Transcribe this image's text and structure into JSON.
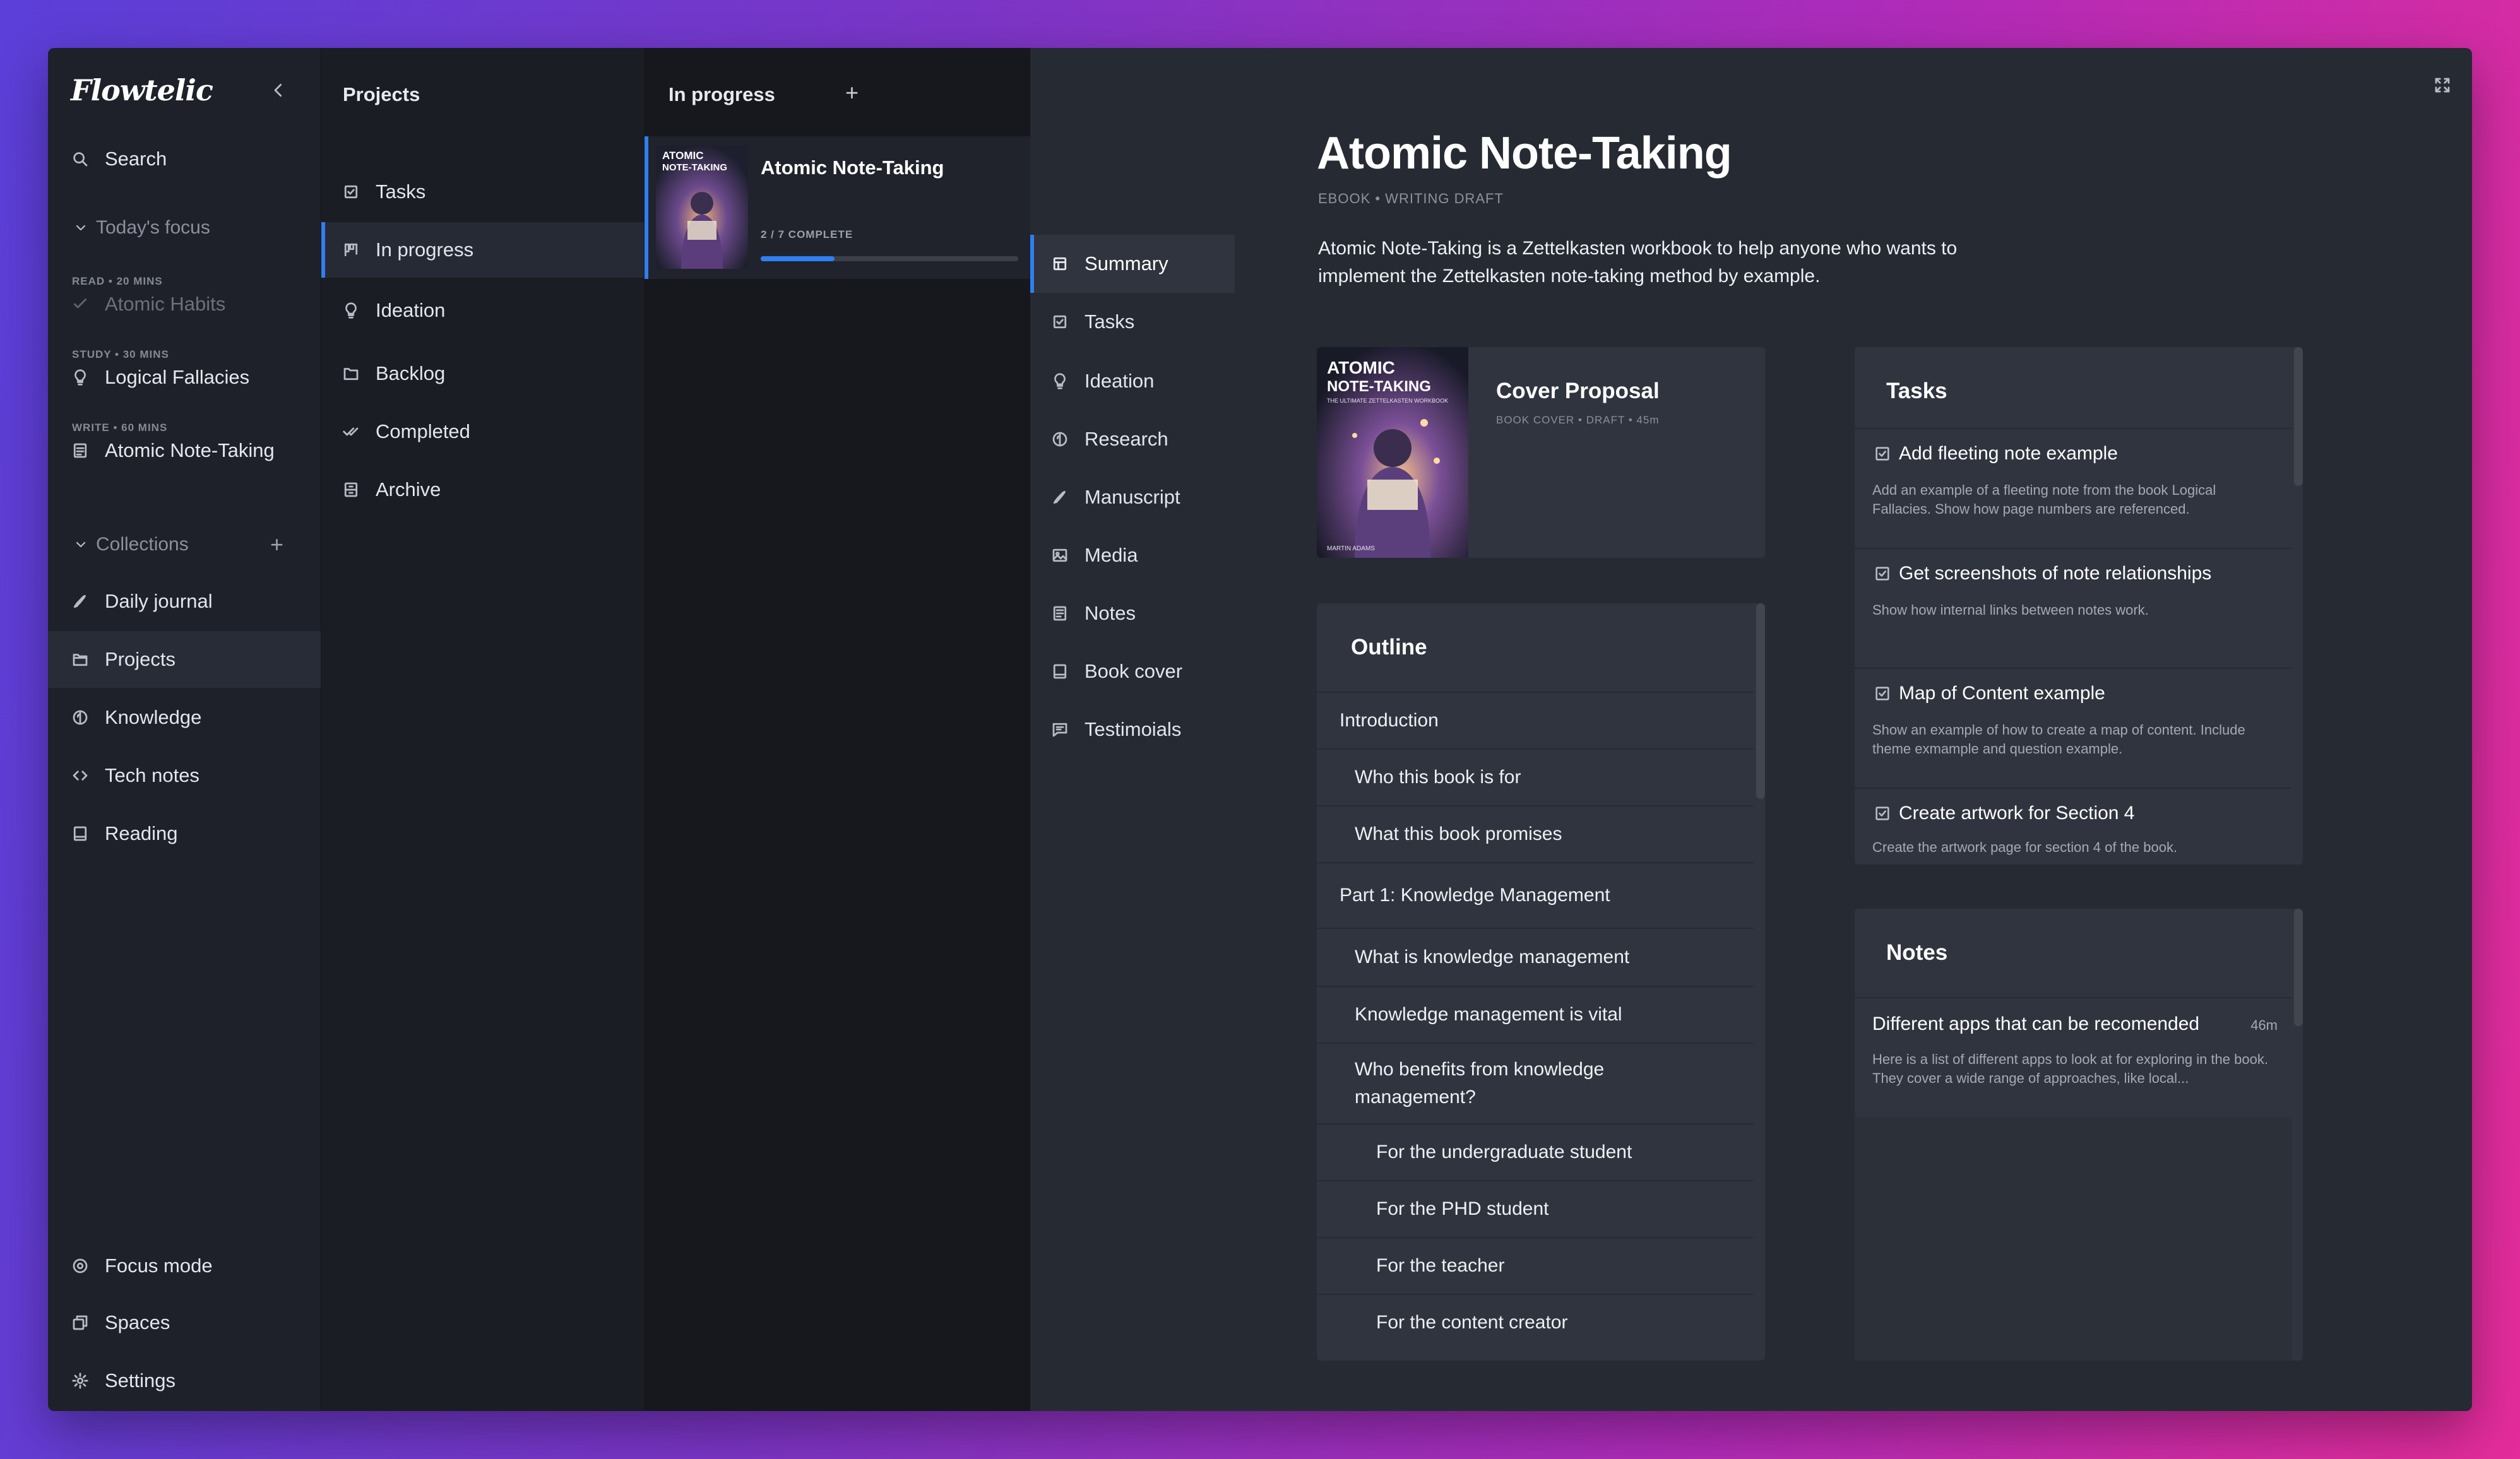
{
  "app": {
    "logo": "Flowtelic"
  },
  "sidebar": {
    "search_label": "Search",
    "todays_focus": {
      "label": "Today's focus",
      "items": [
        {
          "meta": "READ • 20 MINS",
          "label": "Atomic Habits",
          "done": true,
          "icon": "check-icon"
        },
        {
          "meta": "STUDY • 30 MINS",
          "label": "Logical Fallacies",
          "done": false,
          "icon": "bulb-icon"
        },
        {
          "meta": "WRITE • 60 MINS",
          "label": "Atomic Note-Taking",
          "done": false,
          "icon": "document-icon"
        }
      ]
    },
    "collections": {
      "label": "Collections",
      "add_label": "+",
      "items": [
        {
          "label": "Daily journal",
          "icon": "pen-icon"
        },
        {
          "label": "Projects",
          "icon": "folder-icon",
          "active": true
        },
        {
          "label": "Knowledge",
          "icon": "knowledge-icon"
        },
        {
          "label": "Tech notes",
          "icon": "code-icon"
        },
        {
          "label": "Reading",
          "icon": "book-icon"
        }
      ]
    },
    "footer": [
      {
        "label": "Focus mode",
        "icon": "target-icon"
      },
      {
        "label": "Spaces",
        "icon": "spaces-icon"
      },
      {
        "label": "Settings",
        "icon": "gear-icon"
      }
    ]
  },
  "projects": {
    "title": "Projects",
    "items": [
      {
        "label": "Tasks",
        "icon": "checkbox-icon"
      },
      {
        "label": "In progress",
        "icon": "kanban-icon",
        "active": true
      },
      {
        "label": "Ideation",
        "icon": "bulb-icon"
      },
      {
        "label": "Backlog",
        "icon": "folder-icon"
      },
      {
        "label": "Completed",
        "icon": "double-check-icon"
      },
      {
        "label": "Archive",
        "icon": "archive-icon"
      }
    ]
  },
  "in_progress": {
    "title": "In progress",
    "add_label": "+",
    "card": {
      "title": "Atomic Note-Taking",
      "progress_label": "2 / 7 COMPLETE",
      "progress_fraction": 0.2857,
      "cover_title_line1": "ATOMIC",
      "cover_title_line2": "NOTE-TAKING"
    }
  },
  "detail_tabs": [
    {
      "label": "Summary",
      "icon": "summary-icon",
      "active": true
    },
    {
      "label": "Tasks",
      "icon": "checkbox-icon"
    },
    {
      "label": "Ideation",
      "icon": "bulb-icon"
    },
    {
      "label": "Research",
      "icon": "knowledge-icon"
    },
    {
      "label": "Manuscript",
      "icon": "pen-icon"
    },
    {
      "label": "Media",
      "icon": "image-icon"
    },
    {
      "label": "Notes",
      "icon": "notes-icon"
    },
    {
      "label": "Book cover",
      "icon": "book-icon"
    },
    {
      "label": "Testimoials",
      "icon": "quote-icon"
    }
  ],
  "main": {
    "title": "Atomic Note-Taking",
    "subtitle": "EBOOK • WRITING DRAFT",
    "description": "Atomic Note-Taking is a Zettelkasten workbook to help anyone who wants to implement the Zettelkasten note-taking method by example.",
    "cover_card": {
      "title": "Cover Proposal",
      "meta": "BOOK COVER • DRAFT • 45m",
      "cover_line1": "ATOMIC",
      "cover_line2": "NOTE-TAKING",
      "cover_tagline": "THE ULTIMATE ZETTELKASTEN WORKBOOK",
      "cover_author": "MARTIN ADAMS"
    },
    "outline": {
      "title": "Outline",
      "rows": [
        {
          "label": "Introduction",
          "level": 0
        },
        {
          "label": "Who this book is for",
          "level": 1
        },
        {
          "label": "What this book promises",
          "level": 1
        },
        {
          "label": "Part 1: Knowledge Management",
          "level": 0
        },
        {
          "label": "What is knowledge management",
          "level": 1
        },
        {
          "label": "Knowledge management is vital",
          "level": 1
        },
        {
          "label": "Who benefits from knowledge management?",
          "level": 1
        },
        {
          "label": "For the undergraduate student",
          "level": 2
        },
        {
          "label": "For the PHD student",
          "level": 2
        },
        {
          "label": "For the teacher",
          "level": 2
        },
        {
          "label": "For the content creator",
          "level": 2
        }
      ]
    },
    "tasks": {
      "title": "Tasks",
      "items": [
        {
          "title": "Add fleeting note example",
          "desc": "Add an example of a fleeting note from the book Logical Fallacies. Show how page numbers are referenced."
        },
        {
          "title": "Get screenshots of note relationships",
          "desc": "Show how internal links between notes work."
        },
        {
          "title": "Map of Content example",
          "desc": "Show an example of how to create a map of content. Include theme exmample and question example."
        },
        {
          "title": "Create artwork for Section 4",
          "desc": "Create the artwork page for section 4 of the book."
        }
      ]
    },
    "notes": {
      "title": "Notes",
      "items": [
        {
          "title": "Different apps that can be recomended",
          "time": "46m",
          "desc": "Here is a list of different apps to look at for exploring in the book. They cover a wide range of approaches, like local..."
        }
      ]
    }
  },
  "colors": {
    "accent": "#2f7ff0",
    "panel": "#30343e",
    "background": "#262a33"
  }
}
